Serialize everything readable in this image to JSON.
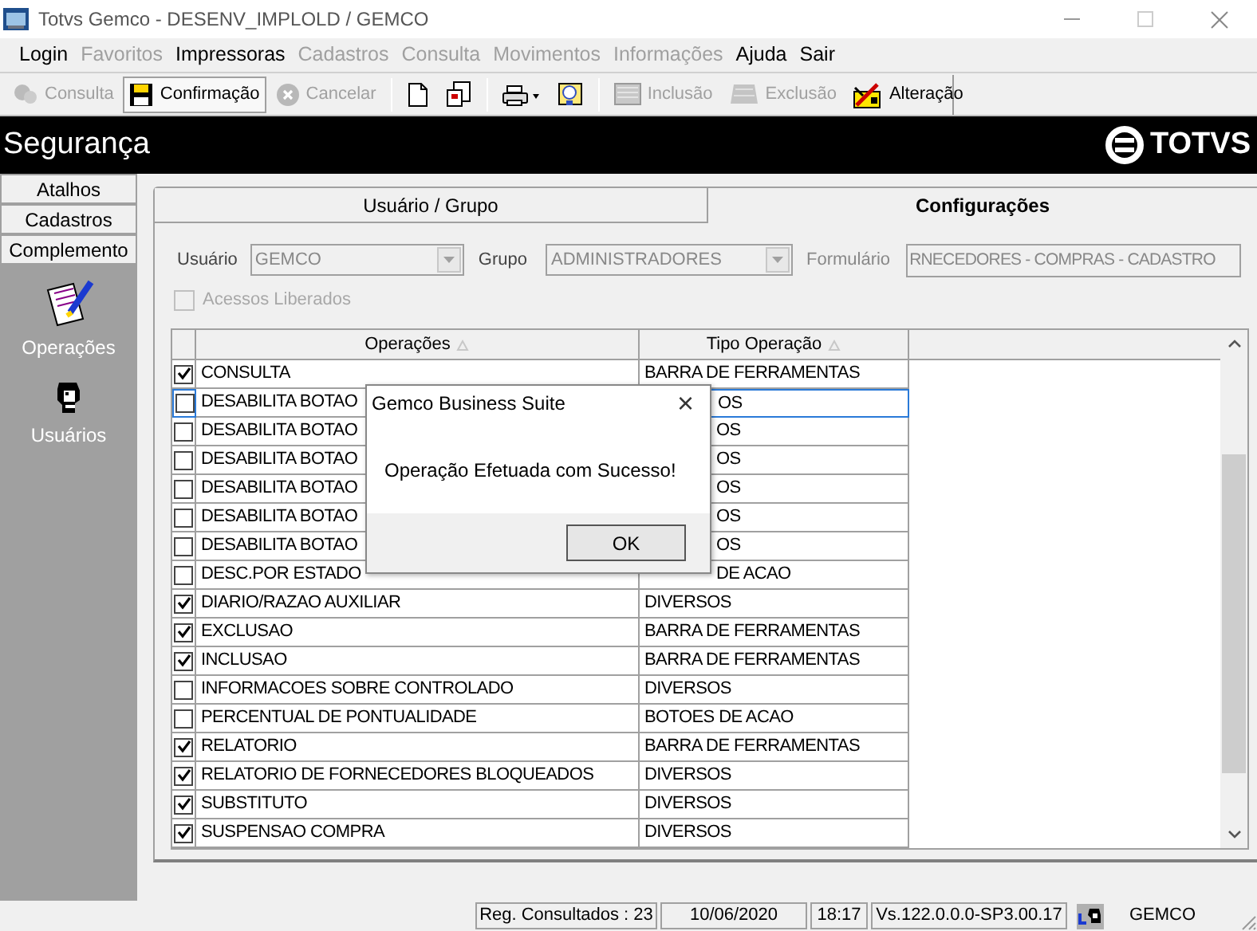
{
  "window": {
    "title": "Totvs Gemco - DESENV_IMPLOLD / GEMCO"
  },
  "menu": [
    {
      "label": "Login",
      "disabled": false
    },
    {
      "label": "Favoritos",
      "disabled": true
    },
    {
      "label": "Impressoras",
      "disabled": false
    },
    {
      "label": "Cadastros",
      "disabled": true
    },
    {
      "label": "Consulta",
      "disabled": true
    },
    {
      "label": "Movimentos",
      "disabled": true
    },
    {
      "label": "Informações",
      "disabled": true
    },
    {
      "label": "Ajuda",
      "disabled": false
    },
    {
      "label": "Sair",
      "disabled": false
    }
  ],
  "toolbar": [
    {
      "label": "Consulta",
      "disabled": true,
      "pressed": false
    },
    {
      "label": "Confirmação",
      "disabled": false,
      "pressed": true
    },
    {
      "label": "Cancelar",
      "disabled": true,
      "pressed": false
    },
    {
      "disabled": false,
      "pressed": false
    },
    {
      "disabled": false,
      "pressed": false
    },
    {
      "disabled": false,
      "pressed": false
    },
    {
      "disabled": false,
      "pressed": false
    },
    {
      "label": "Inclusão",
      "disabled": true,
      "pressed": false
    },
    {
      "label": "Exclusão",
      "disabled": true,
      "pressed": false
    },
    {
      "label": "Alteração",
      "disabled": false,
      "pressed": false
    }
  ],
  "header": {
    "title": "Segurança",
    "logo": "TOTVS"
  },
  "sidebar": {
    "sections": [
      {
        "label": "Atalhos"
      },
      {
        "label": "Cadastros"
      },
      {
        "label": "Complemento"
      }
    ],
    "items": [
      {
        "label": "Operações"
      },
      {
        "label": "Usuários"
      }
    ]
  },
  "tabs": [
    {
      "label": "Usuário  / Grupo",
      "selected": false
    },
    {
      "label": "Configurações",
      "selected": true
    }
  ],
  "form": {
    "user_label": "Usuário",
    "user": "GEMCO",
    "group_label": "Grupo",
    "group": "ADMINISTRADORES",
    "form_label": "Formulário",
    "form_value": "RNECEDORES - COMPRAS - CADASTRO",
    "free_access": {
      "label": "Acessos Liberados",
      "checked": false,
      "disabled": true
    }
  },
  "table": {
    "columns": [
      "Operações",
      "Tipo Operação"
    ],
    "rows": [
      {
        "checked": true,
        "selected": false,
        "partly_hidden": false,
        "operation": "CONSULTA",
        "type": "BARRA DE FERRAMENTAS"
      },
      {
        "checked": false,
        "selected": true,
        "partly_hidden": true,
        "operation": "DESABILITA BOTAO",
        "type": "OS"
      },
      {
        "checked": false,
        "selected": false,
        "partly_hidden": true,
        "operation": "DESABILITA BOTAO",
        "type": "OS"
      },
      {
        "checked": false,
        "selected": false,
        "partly_hidden": true,
        "operation": "DESABILITA BOTAO",
        "type": "OS"
      },
      {
        "checked": false,
        "selected": false,
        "partly_hidden": true,
        "operation": "DESABILITA BOTAO",
        "type": "OS"
      },
      {
        "checked": false,
        "selected": false,
        "partly_hidden": true,
        "operation": "DESABILITA BOTAO",
        "type": "OS"
      },
      {
        "checked": false,
        "selected": false,
        "partly_hidden": true,
        "operation": "DESABILITA BOTAO",
        "type": "OS"
      },
      {
        "checked": false,
        "selected": false,
        "partly_hidden": true,
        "operation": "DESC.POR ESTADO",
        "type": "DE ACAO"
      },
      {
        "checked": true,
        "selected": false,
        "partly_hidden": false,
        "operation": "DIARIO/RAZAO AUXILIAR",
        "type": "DIVERSOS"
      },
      {
        "checked": true,
        "selected": false,
        "partly_hidden": false,
        "operation": "EXCLUSAO",
        "type": "BARRA DE FERRAMENTAS"
      },
      {
        "checked": true,
        "selected": false,
        "partly_hidden": false,
        "operation": "INCLUSAO",
        "type": "BARRA DE FERRAMENTAS"
      },
      {
        "checked": false,
        "selected": false,
        "partly_hidden": false,
        "operation": "INFORMACOES SOBRE CONTROLADO",
        "type": "DIVERSOS"
      },
      {
        "checked": false,
        "selected": false,
        "partly_hidden": false,
        "operation": "PERCENTUAL DE PONTUALIDADE",
        "type": "BOTOES DE ACAO"
      },
      {
        "checked": true,
        "selected": false,
        "partly_hidden": false,
        "operation": "RELATORIO",
        "type": "BARRA DE FERRAMENTAS"
      },
      {
        "checked": true,
        "selected": false,
        "partly_hidden": false,
        "operation": "RELATORIO DE FORNECEDORES BLOQUEADOS",
        "type": "DIVERSOS"
      },
      {
        "checked": true,
        "selected": false,
        "partly_hidden": false,
        "operation": "SUBSTITUTO",
        "type": "DIVERSOS"
      },
      {
        "checked": true,
        "selected": false,
        "partly_hidden": false,
        "operation": "SUSPENSAO COMPRA",
        "type": "DIVERSOS"
      }
    ]
  },
  "dialog": {
    "title": "Gemco Business Suite",
    "close": "×",
    "message": "Operação Efetuada com Sucesso!",
    "button": "OK"
  },
  "status_bar": {
    "records": "Reg. Consultados : 23",
    "date": "10/06/2020",
    "time": "18:17",
    "version": "Vs.122.0.0.0-SP3.00.17",
    "user": "GEMCO"
  }
}
